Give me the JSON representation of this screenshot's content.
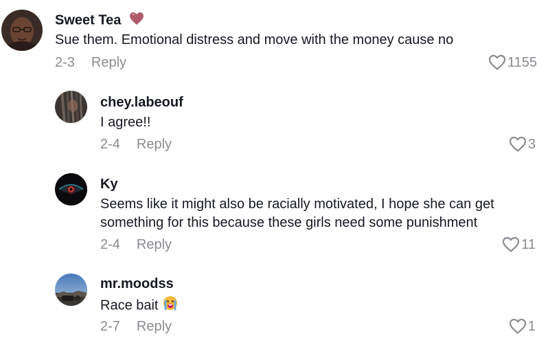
{
  "comments": [
    {
      "username": "Sweet Tea",
      "username_emoji": "heart-emoji",
      "text": "Sue them. Emotional distress and move with the money cause no",
      "date": "2-3",
      "reply_label": "Reply",
      "likes": "1155"
    },
    {
      "username": "chey.labeouf",
      "text": "I agree!!",
      "date": "2-4",
      "reply_label": "Reply",
      "likes": "3"
    },
    {
      "username": "Ky",
      "text_line1": "Seems like it might also be racially motivated, I hope she can get",
      "text_line2": "something for this because these girls need some punishment",
      "date": "2-4",
      "reply_label": "Reply",
      "likes": "11"
    },
    {
      "username": "mr.moodss",
      "text": "Race bait",
      "text_emoji": "crying-face-emoji",
      "date": "2-7",
      "reply_label": "Reply",
      "likes": "1"
    }
  ],
  "colors": {
    "text": "#161823",
    "secondary": "#8a8b91",
    "heart_emoji": "#b05a6a"
  }
}
